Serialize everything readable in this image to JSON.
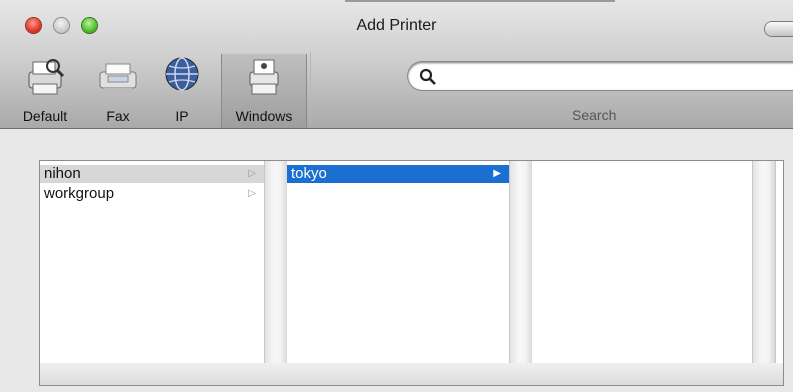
{
  "window": {
    "title": "Add Printer"
  },
  "toolbar": {
    "items": [
      {
        "label": "Default",
        "icon": "default-printer-icon"
      },
      {
        "label": "Fax",
        "icon": "fax-icon"
      },
      {
        "label": "IP",
        "icon": "ip-globe-icon"
      },
      {
        "label": "Windows",
        "icon": "windows-printer-icon",
        "selected": true
      }
    ],
    "search": {
      "value": "",
      "placeholder": "",
      "label": "Search"
    }
  },
  "browser": {
    "columns": [
      {
        "rows": [
          {
            "label": "nihon",
            "has_children": true,
            "selected": true
          },
          {
            "label": "workgroup",
            "has_children": true
          }
        ]
      },
      {
        "rows": [
          {
            "label": "tokyo",
            "has_children": true,
            "selected": true
          }
        ]
      },
      {
        "rows": []
      }
    ]
  },
  "colors": {
    "selection_blue": "#1a6fd0",
    "selection_gray": "#d7d7d7"
  }
}
